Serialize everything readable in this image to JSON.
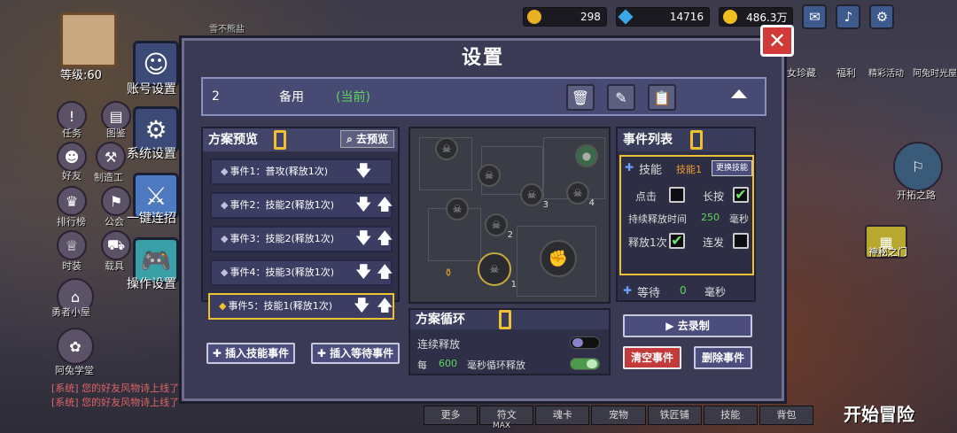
{
  "topbar": {
    "res1": "298",
    "res2": "14716",
    "res3": "486.3万"
  },
  "left": {
    "player_name": "雪不熊盐",
    "level": "等级:60",
    "account": "账号设置",
    "system": "系统设置",
    "combo": "一键连招",
    "ops": "操作设置",
    "small": [
      "任务",
      "图鉴",
      "好友",
      "制造工",
      "排行榜",
      "公会",
      "时装",
      "载具",
      "勇者小屋",
      "阿兔学堂"
    ]
  },
  "right": {
    "goddess": "女珍藏",
    "welfare": "福利",
    "event": "精彩活动",
    "rabbit": "阿兔时光屋",
    "path": "开拓之路",
    "door": "神秘之门",
    "start": "开始冒险"
  },
  "chat": [
    "[系统] 您的好友风物诗上线了",
    "[系统] 您的好友风物诗上线了"
  ],
  "bottombar": [
    "更多",
    "符文",
    "魂卡",
    "宠物",
    "铁匠铺",
    "技能",
    "背包"
  ],
  "bottom_extra": "MAX",
  "dialog": {
    "title": "设置",
    "scheme": {
      "num": "2",
      "name": "备用",
      "current": "(当前)"
    },
    "preview": {
      "title": "方案预览",
      "goto": "去预览",
      "events": [
        "事件1：普攻(释放1次)",
        "事件2：技能2(释放1次)",
        "事件3：技能2(释放1次)",
        "事件4：技能3(释放1次)",
        "事件5：技能1(释放1次)"
      ],
      "insert_skill": "插入技能事件",
      "insert_wait": "插入等待事件"
    },
    "map_nodes": [
      "1",
      "2",
      "3",
      "4"
    ],
    "loop": {
      "title": "方案循环",
      "continuous": "连续释放",
      "every": "每",
      "ms": "600",
      "suffix": "毫秒循环释放"
    },
    "evlist": {
      "title": "事件列表",
      "skill_label": "技能",
      "skill_name": "技能1",
      "change_skill": "更换技能",
      "click": "点击",
      "long_press": "长按",
      "duration": "持续释放时间",
      "duration_val": "250",
      "ms_unit": "毫秒",
      "release_once": "释放1次",
      "rapid": "连发",
      "wait": "等待",
      "wait_val": "0",
      "wait_unit": "毫秒"
    },
    "record": "去录制",
    "clear": "清空事件",
    "delete": "删除事件"
  }
}
